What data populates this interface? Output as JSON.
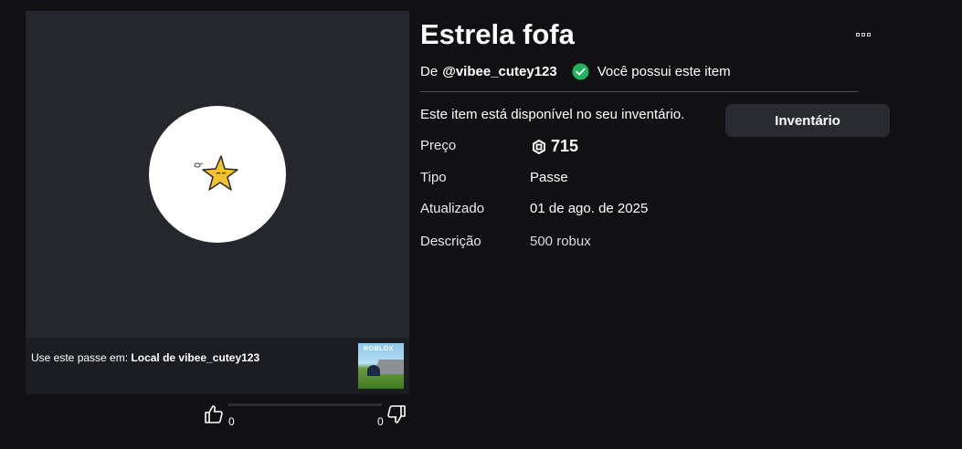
{
  "item": {
    "title": "Estrela fofa",
    "creator_prefix": "De",
    "creator_handle": "@vibee_cutey123",
    "owned_text": "Você possui este item",
    "availability_text": "Este item está disponível no seu inventário.",
    "inventory_button": "Inventário"
  },
  "details": {
    "price_label": "Preço",
    "price_value": "715",
    "type_label": "Tipo",
    "type_value": "Passe",
    "updated_label": "Atualizado",
    "updated_value": "01 de ago. de 2025",
    "description_label": "Descrição",
    "description_value": "500 robux"
  },
  "place": {
    "use_text": "Use este passe em:",
    "place_name": "Local de vibee_cutey123",
    "thumb_logo": "ROBLOX"
  },
  "votes": {
    "up": "0",
    "down": "0",
    "up_fraction": 0,
    "down_fraction": 0
  },
  "icons": {
    "more": "more-options-icon",
    "owned": "check-circle-icon",
    "currency": "robux-icon",
    "upvote": "thumbs-up-icon",
    "downvote": "thumbs-down-icon",
    "item": "star-icon"
  },
  "colors": {
    "background": "#111114",
    "card": "#25272c",
    "owned_check": "#20b35a",
    "button": "#2a2b31",
    "star": "#f5c12e"
  }
}
